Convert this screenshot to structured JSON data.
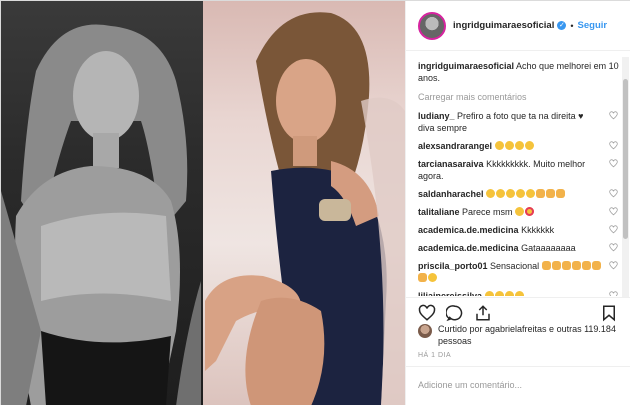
{
  "header": {
    "username": "ingridguimaraesoficial",
    "verified_mark": "✓",
    "separator": "•",
    "follow_label": "Seguir"
  },
  "caption": {
    "username": "ingridguimaraesoficial",
    "text": "Acho que melhorei em 10 anos."
  },
  "load_more_label": "Carregar mais comentários",
  "comments": [
    {
      "user": "ludiany_",
      "text": "Prefiro a foto que ta na direita ♥ diva sempre",
      "emojis": []
    },
    {
      "user": "alexsandrarangel",
      "text": "",
      "emojis": [
        "laugh",
        "laugh",
        "laugh",
        "laugh"
      ]
    },
    {
      "user": "tarcianasaraiva",
      "text": "Kkkkkkkkk. Muito melhor agora.",
      "emojis": []
    },
    {
      "user": "saldanharachel",
      "text": "",
      "emojis": [
        "laugh",
        "laugh",
        "laugh",
        "laugh",
        "laugh",
        "clap",
        "clap",
        "clap"
      ]
    },
    {
      "user": "talitaliane",
      "text": "Parece msm",
      "emojis": [
        "laugh",
        "love"
      ]
    },
    {
      "user": "academica.de.medicina",
      "text": "Kkkkkkk",
      "emojis": []
    },
    {
      "user": "academica.de.medicina",
      "text": "Gataaaaaaaa",
      "emojis": []
    },
    {
      "user": "priscila_porto01",
      "text": "Sensacional",
      "emojis": [
        "clap",
        "clap",
        "clap",
        "clap",
        "clap",
        "clap",
        "clap",
        "laugh"
      ]
    },
    {
      "user": "liliainereissilva",
      "text": "",
      "emojis": [
        "laugh",
        "laugh",
        "laugh",
        "laugh"
      ]
    }
  ],
  "likes": {
    "text": "Curtido por agabrielafreitas e outras 119.184 pessoas"
  },
  "timestamp": "HÁ 1 DIA",
  "comment_input": {
    "placeholder": "Adicione um comentário..."
  },
  "icons": {
    "verified": "verified-badge-icon",
    "like": "heart-icon",
    "comment": "comment-icon",
    "share": "share-icon",
    "save": "bookmark-icon"
  },
  "colors": {
    "accent": "#3897f0",
    "text": "#262626",
    "muted": "#999999",
    "border": "#efefef"
  }
}
